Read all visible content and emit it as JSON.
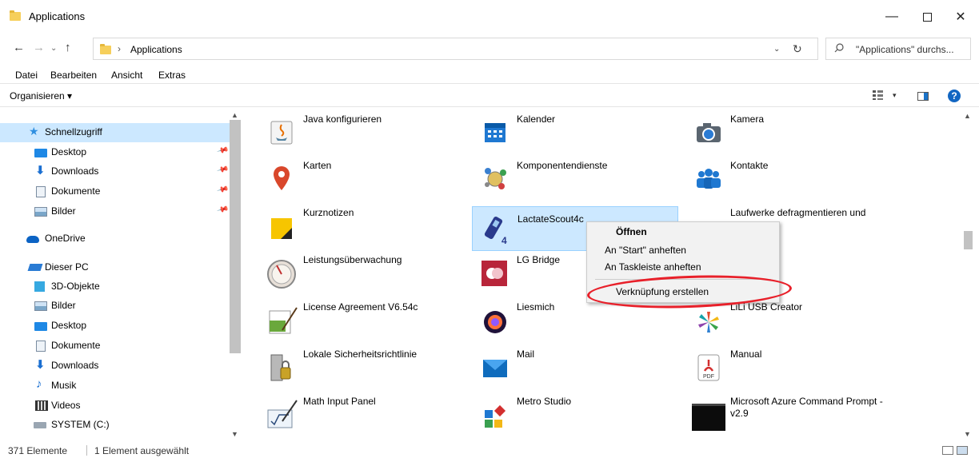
{
  "window": {
    "title": "Applications",
    "minimize_label": "—",
    "close_label": "✕"
  },
  "address": {
    "path": "Applications",
    "separator": "›",
    "search_placeholder": "\"Applications\" durchs..."
  },
  "nav_buttons": {
    "back": "←",
    "forward": "→",
    "recent": "⌄",
    "up": "↑",
    "dropdown": "⌄",
    "refresh": "↻"
  },
  "menubar": [
    "Datei",
    "Bearbeiten",
    "Ansicht",
    "Extras"
  ],
  "toolbar": {
    "organize": "Organisieren ▾",
    "view_dropdown": "▾",
    "help": "?"
  },
  "sidebar": {
    "quick_access": "Schnellzugriff",
    "quick_items": [
      "Desktop",
      "Downloads",
      "Dokumente",
      "Bilder"
    ],
    "onedrive": "OneDrive",
    "this_pc": "Dieser PC",
    "pc_items": [
      "3D-Objekte",
      "Bilder",
      "Desktop",
      "Dokumente",
      "Downloads",
      "Musik",
      "Videos",
      "SYSTEM (C:)"
    ]
  },
  "tiles": [
    [
      "Java konfigurieren",
      "Kalender",
      "Kamera"
    ],
    [
      "Karten",
      "Komponentendienste",
      "Kontakte"
    ],
    [
      "Kurznotizen",
      "LactateScout4c",
      "Laufwerke defragmentieren und"
    ],
    [
      "Leistungsüberwachung",
      "LG Bridge",
      ""
    ],
    [
      "License Agreement V6.54c",
      "Liesmich",
      "LiLi USB Creator"
    ],
    [
      "Lokale Sicherheitsrichtlinie",
      "Mail",
      "Manual"
    ],
    [
      "Math Input Panel",
      "Metro Studio",
      "Microsoft Azure Command Prompt - v2.9"
    ]
  ],
  "selected_tile": "LactateScout4c",
  "context_menu": {
    "open": "Öffnen",
    "pin_start": "An \"Start\" anheften",
    "pin_taskbar": "An Taskleiste anheften",
    "create_shortcut": "Verknüpfung erstellen"
  },
  "status": {
    "count": "371 Elemente",
    "selected": "1 Element ausgewählt"
  },
  "pdf_badge": "PDF"
}
